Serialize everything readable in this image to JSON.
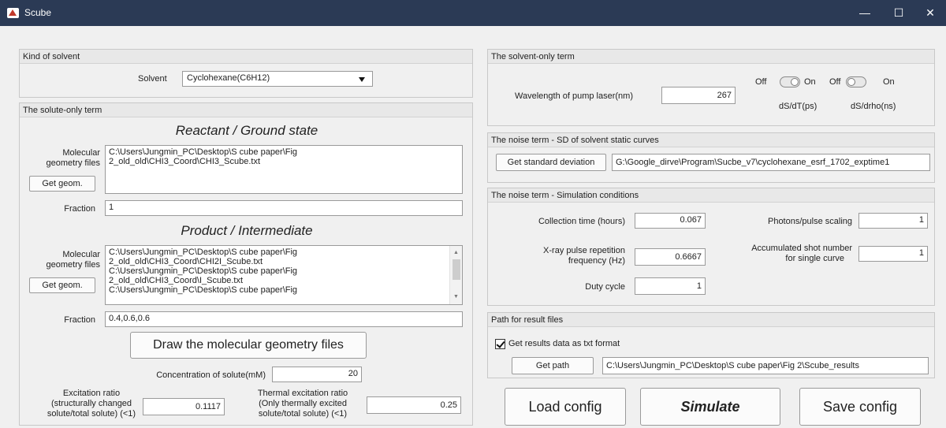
{
  "window": {
    "title": "Scube",
    "minimize_glyph": "—",
    "maximize_glyph": "☐",
    "close_glyph": "✕"
  },
  "solvent_panel": {
    "heading": "Kind of solvent",
    "solvent_label": "Solvent",
    "solvent_value": "Cyclohexane(C6H12)"
  },
  "solute_panel": {
    "heading": "The solute-only term",
    "reactant": {
      "title": "Reactant / Ground state",
      "files_label_1": "Molecular",
      "files_label_2": "geometry files",
      "files": [
        "C:\\Users\\Jungmin_PC\\Desktop\\S cube paper\\Fig",
        "2_old_old\\CHI3_Coord\\CHI3_Scube.txt"
      ],
      "get_geom_label": "Get geom.",
      "fraction_label": "Fraction",
      "fraction_value": "1"
    },
    "product": {
      "title": "Product / Intermediate",
      "files_label_1": "Molecular",
      "files_label_2": "geometry files",
      "files": [
        "C:\\Users\\Jungmin_PC\\Desktop\\S cube paper\\Fig",
        "2_old_old\\CHI3_Coord\\CHI2I_Scube.txt",
        "C:\\Users\\Jungmin_PC\\Desktop\\S cube paper\\Fig",
        "2_old_old\\CHI3_Coord\\I_Scube.txt",
        "C:\\Users\\Jungmin_PC\\Desktop\\S cube paper\\Fig"
      ],
      "get_geom_label": "Get geom.",
      "fraction_label": "Fraction",
      "fraction_value": "0.4,0.6,0.6"
    },
    "draw_button": "Draw the molecular geometry files",
    "concentration_label": "Concentration of solute(mM)",
    "concentration_value": "20",
    "excitation_label": [
      "Excitation ratio",
      "(structurally changed",
      "solute/total solute) (<1)"
    ],
    "excitation_value": "0.1117",
    "thermal_label": [
      "Thermal excitation ratio",
      "(Only thermally excited",
      "solute/total solute) (<1)"
    ],
    "thermal_value": "0.25"
  },
  "solvent_only": {
    "heading": "The solvent-only term",
    "wavelength_label": "Wavelength of pump laser(nm)",
    "wavelength_value": "267",
    "toggle1": {
      "off": "Off",
      "on": "On",
      "caption": "dS/dT(ps)",
      "state": "on"
    },
    "toggle2": {
      "off": "Off",
      "on": "On",
      "caption": "dS/drho(ns)",
      "state": "off"
    }
  },
  "noise_sd": {
    "heading": "The noise term - SD of solvent static curves",
    "button": "Get standard deviation",
    "path": "G:\\Google_dirve\\Program\\Sucbe_v7\\cyclohexane_esrf_1702_exptime1"
  },
  "noise_sim": {
    "heading": "The noise term - Simulation conditions",
    "collection_label": "Collection time (hours)",
    "collection_value": "0.067",
    "xray_label": [
      "X-ray pulse repetition",
      "frequency (Hz)"
    ],
    "xray_value": "0.6667",
    "duty_label": "Duty cycle",
    "duty_value": "1",
    "photons_label": "Photons/pulse scaling",
    "photons_value": "1",
    "shots_label": [
      "Accumulated shot number",
      "for single curve"
    ],
    "shots_value": "1"
  },
  "result_path": {
    "heading": "Path for result files",
    "checkbox_label": "Get results data as txt format",
    "get_path_label": "Get path",
    "path": "C:\\Users\\Jungmin_PC\\Desktop\\S cube paper\\Fig 2\\Scube_results"
  },
  "actions": {
    "load": "Load config",
    "simulate": "Simulate",
    "save": "Save config"
  }
}
